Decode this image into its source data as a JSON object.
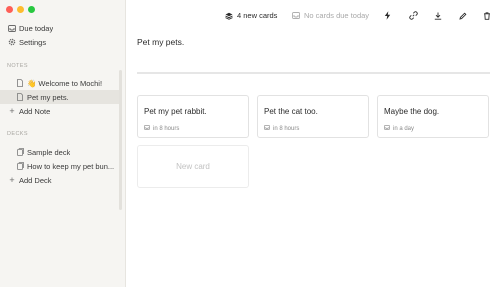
{
  "sidebar": {
    "top_items": [
      {
        "label": "Due today",
        "icon": "inbox-icon"
      },
      {
        "label": "Settings",
        "icon": "gear-icon"
      }
    ],
    "notes_label": "NOTES",
    "notes": [
      {
        "label": "👋 Welcome to Mochi!",
        "selected": false
      },
      {
        "label": "Pet my pets.",
        "selected": true
      }
    ],
    "add_note": "Add Note",
    "decks_label": "DECKS",
    "decks": [
      {
        "label": "Sample deck"
      },
      {
        "label": "How to keep my pet bun..."
      }
    ],
    "add_deck": "Add Deck"
  },
  "toolbar": {
    "new_cards": "4 new cards",
    "no_cards_due": "No cards due today"
  },
  "note": {
    "title": "Pet my pets."
  },
  "cards": [
    {
      "front": "Pet my pet rabbit.",
      "due": "in 8 hours"
    },
    {
      "front": "Pet the cat too.",
      "due": "in 8 hours"
    },
    {
      "front": "Maybe the dog.",
      "due": "in a day"
    }
  ],
  "new_card_label": "New card",
  "colors": {
    "sidebar_bg": "#f6f5f2",
    "selected_bg": "#e6e4df",
    "text": "#2f2f2f",
    "muted": "#8a8a8a"
  }
}
